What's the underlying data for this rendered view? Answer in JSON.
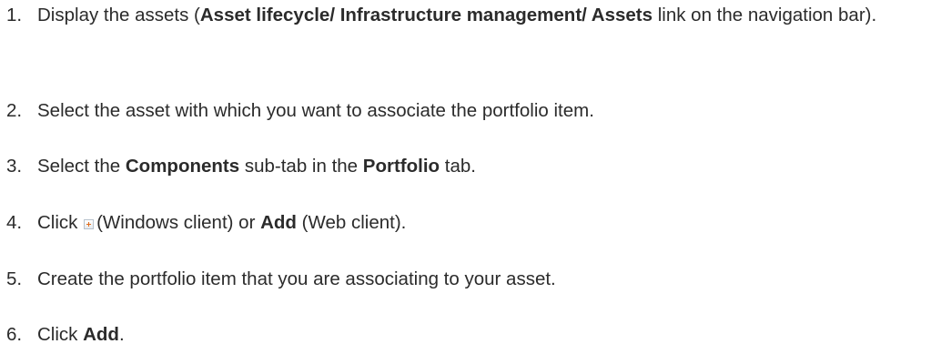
{
  "steps": [
    {
      "number": "1.",
      "parts": [
        "Display the assets (",
        "Asset lifecycle/ Infrastructure management/ Assets",
        " link on the navigation bar)."
      ]
    },
    {
      "number": "2.",
      "parts": [
        "Select the asset with which you want to associate the portfolio item."
      ]
    },
    {
      "number": "3.",
      "parts": [
        "Select the ",
        "Components",
        " sub-tab in the ",
        "Portfolio",
        " tab."
      ]
    },
    {
      "number": "4.",
      "parts": [
        "Click ",
        "(Windows client) or ",
        "Add",
        " (Web client)."
      ],
      "icon": "add-icon"
    },
    {
      "number": "5.",
      "parts": [
        "Create the portfolio item that you are associating to your asset."
      ]
    },
    {
      "number": "6.",
      "parts": [
        "Click ",
        "Add",
        "."
      ]
    }
  ]
}
